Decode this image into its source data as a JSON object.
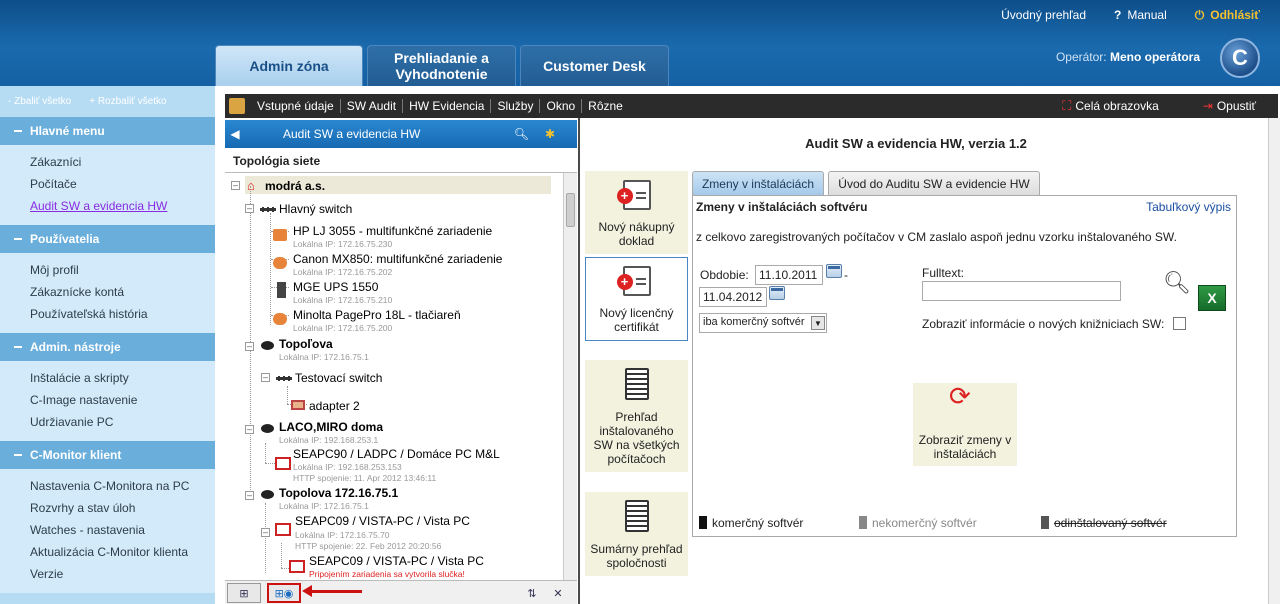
{
  "header": {
    "links": {
      "overview": "Úvodný prehľad",
      "manual": "Manual",
      "logout": "Odhlásiť"
    },
    "operator_label": "Operátor:",
    "operator_name": "Meno operátora",
    "logo_letter": "C",
    "tabs": [
      {
        "label": "Admin zóna",
        "active": true
      },
      {
        "label": "Prehliadanie a Vyhodnotenie",
        "active": false
      },
      {
        "label": "Customer Desk",
        "active": false
      }
    ]
  },
  "sidebar": {
    "collapse_all": "- Zbaliť všetko",
    "expand_all": "+ Rozbaliť všetko",
    "groups": [
      {
        "title": "Hlavné menu",
        "items": [
          "Zákazníci",
          "Počítače",
          "Audit SW a evidencia HW"
        ]
      },
      {
        "title": "Používatelia",
        "items": [
          "Môj profil",
          "Zákaznícke kontá",
          "Používateľská história"
        ]
      },
      {
        "title": "Admin. nástroje",
        "items": [
          "Inštalácie a skripty",
          "C-Image nastavenie",
          "Udržiavanie PC"
        ]
      },
      {
        "title": "C-Monitor klient",
        "items": [
          "Nastavenia C-Monitora na PC",
          "Rozvrhy a stav úloh",
          "Watches - nastavenia",
          "Aktualizácia C-Monitor klienta",
          "Verzie"
        ]
      }
    ],
    "active_item": "Audit SW a evidencia HW"
  },
  "menubar": {
    "items": [
      "Vstupné údaje",
      "SW Audit",
      "HW Evidencia",
      "Služby",
      "Okno",
      "Rôzne"
    ],
    "fullscreen": "Celá obrazovka",
    "exit": "Opustiť"
  },
  "tree": {
    "title": "Audit SW a evidencia HW",
    "topology_label": "Topológia siete",
    "nodes": {
      "root": "modrá a.s.",
      "main_switch": "Hlavný switch",
      "hp": "HP LJ 3055 - multifunkčné zariadenie",
      "hp_ip": "Lokálna IP: 172.16.75.230",
      "canon": "Canon MX850: multifunkčné zariadenie",
      "canon_ip": "Lokálna IP: 172.16.75.202",
      "mge": "MGE UPS 1550",
      "mge_ip": "Lokálna IP: 172.16.75.210",
      "minolta": "Minolta PagePro 18L - tlačiareň",
      "minolta_ip": "Lokálna IP: 172.16.75.200",
      "topolova": "Topoľova",
      "topolova_ip": "Lokálna IP: 172.16.75.1",
      "test_switch": "Testovací switch",
      "adapter": "adapter 2",
      "laco": "LACO,MIRO doma",
      "laco_ip": "Lokálna IP: 192.168.253.1",
      "seapc90": "SEAPC90 / LADPC / Domáce PC M&L",
      "seapc90_ip": "Lokálna IP: 192.168.253.153",
      "seapc90_http": "HTTP spojenie: 11. Apr 2012 13:46:11",
      "topolova2": "Topolova 172.16.75.1",
      "topolova2_ip": "Lokálna IP: 172.16.75.1",
      "seapc09": "SEAPC09 / VISTA-PC / Vista PC",
      "seapc09_ip": "Lokálna IP: 172.16.75.70",
      "seapc09_http": "HTTP spojenie: 22. Feb 2012 20:20:56",
      "seapc09b": "SEAPC09 / VISTA-PC / Vista PC",
      "seapc09b_warn": "Pripojením zariadenia sa vytvorila slučka!"
    }
  },
  "main": {
    "title": "Audit SW a evidencia HW, verzia 1.2",
    "side_buttons": [
      "Nový nákupný doklad",
      "Nový licenčný certifikát",
      "Prehľad inštalovaného SW na všetkých počítačoch",
      "Sumárny prehľad spoločnosti"
    ],
    "tabs": [
      "Zmeny v inštaláciách",
      "Úvod do Auditu SW a evidencie HW"
    ],
    "section_title": "Zmeny v inštaláciách softvéru",
    "table_link": "Tabuľkový výpis",
    "info_text": "z celkovo zaregistrovaných počítačov v CM zaslalo aspoň jednu vzorku inštalovaného SW.",
    "period_label": "Obdobie:",
    "date_from": "11.10.2011",
    "date_to": "11.04.2012",
    "dash": "-",
    "sw_filter": "iba komerčný softvér",
    "fulltext_label": "Fulltext:",
    "fulltext_value": "",
    "show_new_libs": "Zobraziť informácie o nových knižniciach SW:",
    "show_changes_btn": "Zobraziť zmeny v inštaláciách",
    "legend": {
      "commercial": "komerčný softvér",
      "noncommercial": "nekomerčný softvér",
      "uninstalled": "odinštalovaný softvér"
    },
    "colors": {
      "commercial": "#111111",
      "noncommercial": "#888888",
      "uninstalled": "#555555"
    }
  }
}
